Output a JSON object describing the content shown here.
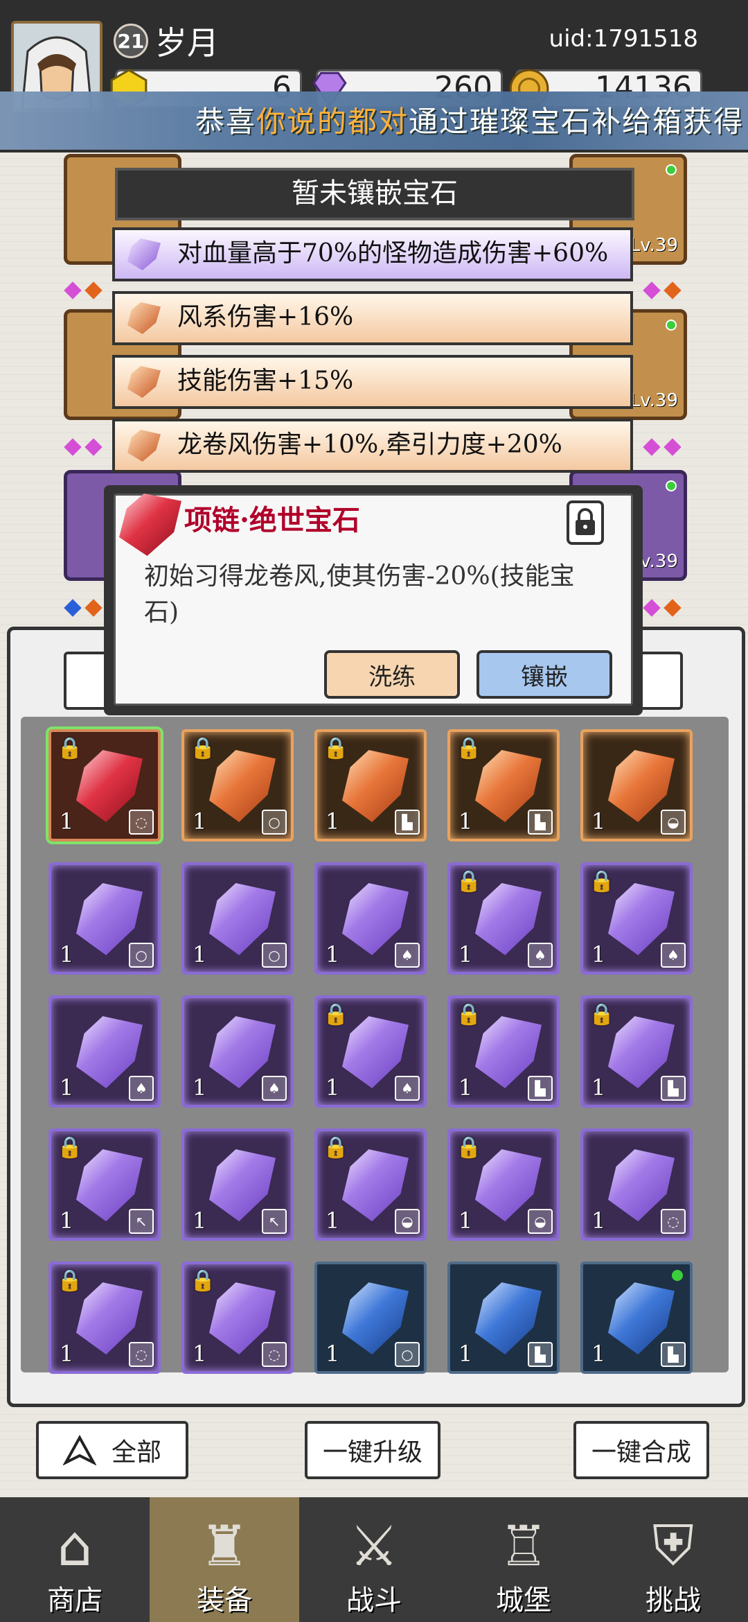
{
  "player": {
    "level": "21",
    "name": "岁月",
    "uid": "uid:1791518"
  },
  "resources": [
    {
      "icon": "gold-gem-icon",
      "value": "6"
    },
    {
      "icon": "diamond-icon",
      "value": "260"
    },
    {
      "icon": "coin-icon",
      "value": "14136"
    }
  ],
  "banner": {
    "prefix": "恭喜",
    "highlight": "你说的都对",
    "suffix": "通过璀璨宝石补给箱获得"
  },
  "slots": {
    "lv_top_right": "Lv.39",
    "lv_mid_right": "Lv.39",
    "lv_lower_right": "Lv.39"
  },
  "gem_list": {
    "header": "暂未镶嵌宝石",
    "items": [
      {
        "label": "对血量高于70%的怪物造成伤害+60%",
        "color": "purple"
      },
      {
        "label": "风系伤害+16%",
        "color": "orange"
      },
      {
        "label": "技能伤害+15%",
        "color": "orange"
      },
      {
        "label": "龙卷风伤害+10%,牵引力度+20%",
        "color": "orange"
      }
    ]
  },
  "detail": {
    "title": "项链·绝世宝石",
    "description": "初始习得龙卷风,使其伤害-20%(技能宝石)",
    "refine_label": "洗练",
    "inlay_label": "镶嵌"
  },
  "inventory": [
    {
      "color": "red",
      "count": "1",
      "locked": true,
      "tag": "necklace",
      "selected": true
    },
    {
      "color": "orange",
      "count": "1",
      "locked": true,
      "tag": "ring"
    },
    {
      "color": "orange",
      "count": "1",
      "locked": true,
      "tag": "boots"
    },
    {
      "color": "orange",
      "count": "1",
      "locked": true,
      "tag": "boots"
    },
    {
      "color": "orange",
      "count": "1",
      "locked": false,
      "tag": "hat"
    },
    {
      "color": "purple",
      "count": "1",
      "locked": false,
      "tag": "ring"
    },
    {
      "color": "purple",
      "count": "1",
      "locked": false,
      "tag": "ring"
    },
    {
      "color": "purple",
      "count": "1",
      "locked": false,
      "tag": "cape"
    },
    {
      "color": "purple",
      "count": "1",
      "locked": true,
      "tag": "cape"
    },
    {
      "color": "purple",
      "count": "1",
      "locked": true,
      "tag": "cape"
    },
    {
      "color": "purple",
      "count": "1",
      "locked": false,
      "tag": "cape"
    },
    {
      "color": "purple",
      "count": "1",
      "locked": false,
      "tag": "cape"
    },
    {
      "color": "purple",
      "count": "1",
      "locked": true,
      "tag": "cape"
    },
    {
      "color": "purple",
      "count": "1",
      "locked": true,
      "tag": "boots"
    },
    {
      "color": "purple",
      "count": "1",
      "locked": true,
      "tag": "boots"
    },
    {
      "color": "purple",
      "count": "1",
      "locked": true,
      "tag": "weapon"
    },
    {
      "color": "purple",
      "count": "1",
      "locked": false,
      "tag": "weapon"
    },
    {
      "color": "purple",
      "count": "1",
      "locked": true,
      "tag": "hat"
    },
    {
      "color": "purple",
      "count": "1",
      "locked": true,
      "tag": "hat"
    },
    {
      "color": "purple",
      "count": "1",
      "locked": false,
      "tag": "necklace"
    },
    {
      "color": "purple",
      "count": "1",
      "locked": true,
      "tag": "necklace"
    },
    {
      "color": "purple",
      "count": "1",
      "locked": true,
      "tag": "necklace"
    },
    {
      "color": "blue",
      "count": "1",
      "locked": false,
      "tag": "ring"
    },
    {
      "color": "blue",
      "count": "1",
      "locked": false,
      "tag": "boots"
    },
    {
      "color": "blue",
      "count": "1",
      "locked": false,
      "tag": "boots",
      "new": true
    }
  ],
  "actions": {
    "filter_label": "全部",
    "upgrade_label": "一键升级",
    "combine_label": "一键合成"
  },
  "nav": [
    {
      "label": "商店",
      "icon": "shop-icon",
      "active": false
    },
    {
      "label": "装备",
      "icon": "bag-icon",
      "active": true
    },
    {
      "label": "战斗",
      "icon": "swords-icon",
      "active": false
    },
    {
      "label": "城堡",
      "icon": "castle-icon",
      "active": false
    },
    {
      "label": "挑战",
      "icon": "shield-icon",
      "active": false
    }
  ],
  "colors": {
    "accent_highlight": "#ffb23a",
    "title_red": "#b0002a",
    "selected_outline": "#7de36a"
  }
}
